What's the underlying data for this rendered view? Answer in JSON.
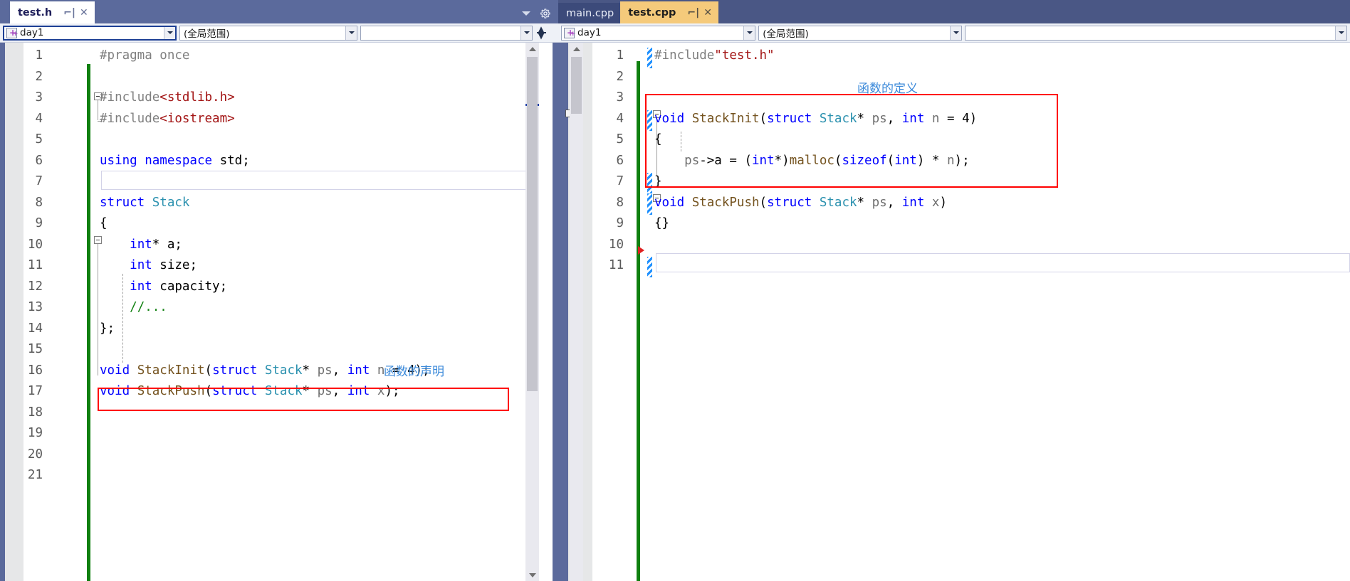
{
  "left_pane": {
    "tab": {
      "name": "test.h",
      "pin_icon": "pin-icon",
      "close_icon": "close-icon",
      "state": "active"
    },
    "tabstrip_tools": {
      "dropdown_icon": "chevron-down-icon",
      "settings_icon": "gear-icon"
    },
    "navbar": {
      "project_value": "day1",
      "project_icon": "project-icon",
      "scope_value": "(全局范围)",
      "member_value": "",
      "split_icon": "split-view-icon"
    },
    "lines": [
      {
        "n": "1",
        "tokens": [
          {
            "t": "#pragma once",
            "c": "pp"
          }
        ]
      },
      {
        "n": "2",
        "tokens": []
      },
      {
        "n": "3",
        "tokens": [
          {
            "t": "#include",
            "c": "pp"
          },
          {
            "t": "<stdlib.h>",
            "c": "str"
          }
        ]
      },
      {
        "n": "4",
        "tokens": [
          {
            "t": "#include",
            "c": "pp"
          },
          {
            "t": "<iostream>",
            "c": "str"
          }
        ]
      },
      {
        "n": "5",
        "tokens": []
      },
      {
        "n": "6",
        "tokens": [
          {
            "t": "using namespace",
            "c": "k"
          },
          {
            "t": " std;",
            "c": "plain"
          }
        ]
      },
      {
        "n": "7",
        "tokens": []
      },
      {
        "n": "8",
        "tokens": [
          {
            "t": "struct",
            "c": "k"
          },
          {
            "t": " ",
            "c": "plain"
          },
          {
            "t": "Stack",
            "c": "type"
          }
        ]
      },
      {
        "n": "9",
        "tokens": [
          {
            "t": "{",
            "c": "plain"
          }
        ]
      },
      {
        "n": "10",
        "tokens": [
          {
            "t": "    ",
            "c": "plain"
          },
          {
            "t": "int",
            "c": "k"
          },
          {
            "t": "* a;",
            "c": "plain"
          }
        ]
      },
      {
        "n": "11",
        "tokens": [
          {
            "t": "    ",
            "c": "plain"
          },
          {
            "t": "int",
            "c": "k"
          },
          {
            "t": " size;",
            "c": "plain"
          }
        ]
      },
      {
        "n": "12",
        "tokens": [
          {
            "t": "    ",
            "c": "plain"
          },
          {
            "t": "int",
            "c": "k"
          },
          {
            "t": " capacity;",
            "c": "plain"
          }
        ]
      },
      {
        "n": "13",
        "tokens": [
          {
            "t": "    ",
            "c": "plain"
          },
          {
            "t": "//...",
            "c": "cmt"
          }
        ]
      },
      {
        "n": "14",
        "tokens": [
          {
            "t": "};",
            "c": "plain"
          }
        ]
      },
      {
        "n": "15",
        "tokens": []
      },
      {
        "n": "16",
        "tokens": [
          {
            "t": "void",
            "c": "k"
          },
          {
            "t": " ",
            "c": "plain"
          },
          {
            "t": "StackInit",
            "c": "func"
          },
          {
            "t": "(",
            "c": "plain"
          },
          {
            "t": "struct",
            "c": "k"
          },
          {
            "t": " ",
            "c": "plain"
          },
          {
            "t": "Stack",
            "c": "type"
          },
          {
            "t": "* ",
            "c": "plain"
          },
          {
            "t": "ps",
            "c": "ident"
          },
          {
            "t": ", ",
            "c": "plain"
          },
          {
            "t": "int",
            "c": "k"
          },
          {
            "t": " ",
            "c": "plain"
          },
          {
            "t": "n",
            "c": "ident"
          },
          {
            "t": " = 4);",
            "c": "plain"
          }
        ]
      },
      {
        "n": "17",
        "tokens": [
          {
            "t": "void",
            "c": "k"
          },
          {
            "t": " ",
            "c": "plain"
          },
          {
            "t": "StackPush",
            "c": "func"
          },
          {
            "t": "(",
            "c": "plain"
          },
          {
            "t": "struct",
            "c": "k"
          },
          {
            "t": " ",
            "c": "plain"
          },
          {
            "t": "Stack",
            "c": "type"
          },
          {
            "t": "* ",
            "c": "plain"
          },
          {
            "t": "ps",
            "c": "ident"
          },
          {
            "t": ", ",
            "c": "plain"
          },
          {
            "t": "int",
            "c": "k"
          },
          {
            "t": " ",
            "c": "plain"
          },
          {
            "t": "x",
            "c": "ident"
          },
          {
            "t": ");",
            "c": "plain"
          }
        ]
      },
      {
        "n": "18",
        "tokens": []
      },
      {
        "n": "19",
        "tokens": []
      },
      {
        "n": "20",
        "tokens": []
      },
      {
        "n": "21",
        "tokens": []
      }
    ],
    "annotation": {
      "text": "函数的声明",
      "color": "#3c8ada"
    },
    "highlight_box_color": "#ff0000"
  },
  "right_pane": {
    "tabs": [
      {
        "name": "main.cpp",
        "state": "inactive"
      },
      {
        "name": "test.cpp",
        "state": "active",
        "pin_icon": "pin-icon",
        "close_icon": "close-icon"
      }
    ],
    "navbar": {
      "project_value": "day1",
      "project_icon": "project-icon",
      "scope_value": "(全局范围)",
      "member_value": ""
    },
    "lines": [
      {
        "n": "1",
        "tokens": [
          {
            "t": "#include",
            "c": "pp"
          },
          {
            "t": "\"test.h\"",
            "c": "str"
          }
        ]
      },
      {
        "n": "2",
        "tokens": []
      },
      {
        "n": "3",
        "tokens": []
      },
      {
        "n": "4",
        "tokens": [
          {
            "t": "void",
            "c": "k"
          },
          {
            "t": " ",
            "c": "plain"
          },
          {
            "t": "StackInit",
            "c": "func"
          },
          {
            "t": "(",
            "c": "plain"
          },
          {
            "t": "struct",
            "c": "k"
          },
          {
            "t": " ",
            "c": "plain"
          },
          {
            "t": "Stack",
            "c": "type"
          },
          {
            "t": "* ",
            "c": "plain"
          },
          {
            "t": "ps",
            "c": "ident"
          },
          {
            "t": ", ",
            "c": "plain"
          },
          {
            "t": "int",
            "c": "k"
          },
          {
            "t": " ",
            "c": "plain"
          },
          {
            "t": "n",
            "c": "ident"
          },
          {
            "t": " = 4)",
            "c": "plain"
          }
        ]
      },
      {
        "n": "5",
        "tokens": [
          {
            "t": "{",
            "c": "plain"
          }
        ]
      },
      {
        "n": "6",
        "tokens": [
          {
            "t": "    ",
            "c": "plain"
          },
          {
            "t": "ps",
            "c": "ident"
          },
          {
            "t": "->a = (",
            "c": "plain"
          },
          {
            "t": "int",
            "c": "k"
          },
          {
            "t": "*)",
            "c": "plain"
          },
          {
            "t": "malloc",
            "c": "func"
          },
          {
            "t": "(",
            "c": "plain"
          },
          {
            "t": "sizeof",
            "c": "k"
          },
          {
            "t": "(",
            "c": "plain"
          },
          {
            "t": "int",
            "c": "k"
          },
          {
            "t": ") * ",
            "c": "plain"
          },
          {
            "t": "n",
            "c": "ident"
          },
          {
            "t": ");",
            "c": "plain"
          }
        ]
      },
      {
        "n": "7",
        "tokens": [
          {
            "t": "}",
            "c": "plain"
          }
        ]
      },
      {
        "n": "8",
        "tokens": [
          {
            "t": "void",
            "c": "k"
          },
          {
            "t": " ",
            "c": "plain"
          },
          {
            "t": "StackPush",
            "c": "func"
          },
          {
            "t": "(",
            "c": "plain"
          },
          {
            "t": "struct",
            "c": "k"
          },
          {
            "t": " ",
            "c": "plain"
          },
          {
            "t": "Stack",
            "c": "type"
          },
          {
            "t": "* ",
            "c": "plain"
          },
          {
            "t": "ps",
            "c": "ident"
          },
          {
            "t": ", ",
            "c": "plain"
          },
          {
            "t": "int",
            "c": "k"
          },
          {
            "t": " ",
            "c": "plain"
          },
          {
            "t": "x",
            "c": "ident"
          },
          {
            "t": ")",
            "c": "plain"
          }
        ]
      },
      {
        "n": "9",
        "tokens": [
          {
            "t": "{}",
            "c": "plain"
          }
        ]
      },
      {
        "n": "10",
        "tokens": []
      },
      {
        "n": "11",
        "tokens": []
      }
    ],
    "annotation": {
      "text": "函数的定义",
      "color": "#3c8ada"
    },
    "highlight_box_color": "#ff0000",
    "glyphs": {
      "bookmark_icon": "bookmark-icon",
      "breakpoint_icon": "breakpoint-arrow-icon"
    }
  },
  "colors": {
    "tab_active_left": "#ffffff",
    "tab_active_right": "#f5ca7b",
    "tab_inactive": "#3c4a7a",
    "tabstrip_bg": "#5b6a9c",
    "annotation": "#3c8ada",
    "redbox": "#ff0000",
    "change_saved": "#108010",
    "change_unsaved": "#1e90ff",
    "keyword": "#0000ff",
    "preproc": "#808080",
    "string": "#a31515",
    "type": "#2b91af",
    "function": "#74531f",
    "comment": "#108010"
  }
}
